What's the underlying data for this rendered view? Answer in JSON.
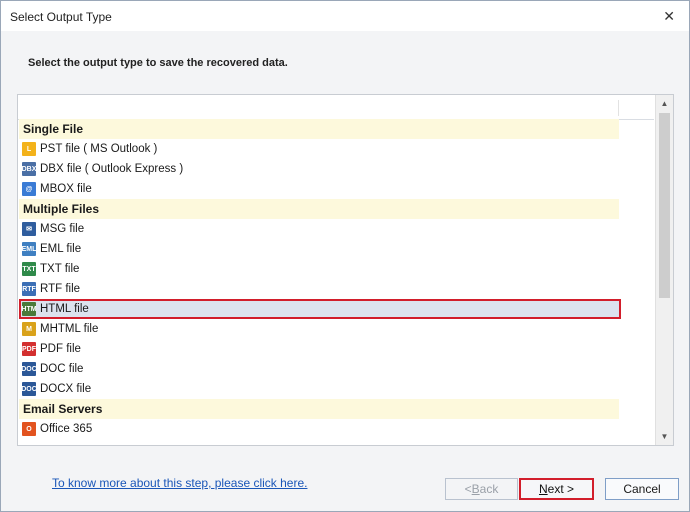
{
  "window": {
    "title": "Select Output Type",
    "close_glyph": "✕"
  },
  "instruction": "Select the output type to save the recovered data.",
  "list": {
    "rows": [
      {
        "type": "group",
        "label": "Single File"
      },
      {
        "type": "item",
        "label": "PST file ( MS Outlook )",
        "icon": "pst-file-icon",
        "icon_text": "L",
        "icon_color": "#f3b21a"
      },
      {
        "type": "item",
        "label": "DBX file ( Outlook Express )",
        "icon": "dbx-file-icon",
        "icon_text": "DBX",
        "icon_color": "#4a6fa5"
      },
      {
        "type": "item",
        "label": "MBOX file",
        "icon": "mbox-file-icon",
        "icon_text": "@",
        "icon_color": "#3a7bd5"
      },
      {
        "type": "group",
        "label": "Multiple Files"
      },
      {
        "type": "item",
        "label": "MSG file",
        "icon": "msg-file-icon",
        "icon_text": "✉",
        "icon_color": "#2f5d9e"
      },
      {
        "type": "item",
        "label": "EML file",
        "icon": "eml-file-icon",
        "icon_text": "EML",
        "icon_color": "#3f7fc1"
      },
      {
        "type": "item",
        "label": "TXT file",
        "icon": "txt-file-icon",
        "icon_text": "TXT",
        "icon_color": "#2f8a4a"
      },
      {
        "type": "item",
        "label": "RTF file",
        "icon": "rtf-file-icon",
        "icon_text": "RTF",
        "icon_color": "#3b6fb6"
      },
      {
        "type": "item",
        "label": "HTML file",
        "icon": "html-file-icon",
        "icon_text": "HTM",
        "icon_color": "#4a7a3a",
        "selected": true
      },
      {
        "type": "item",
        "label": "MHTML file",
        "icon": "mhtml-file-icon",
        "icon_text": "M",
        "icon_color": "#d9a21b"
      },
      {
        "type": "item",
        "label": "PDF file",
        "icon": "pdf-file-icon",
        "icon_text": "PDF",
        "icon_color": "#d32f2f"
      },
      {
        "type": "item",
        "label": "DOC file",
        "icon": "doc-file-icon",
        "icon_text": "DOC",
        "icon_color": "#2b5797"
      },
      {
        "type": "item",
        "label": "DOCX file",
        "icon": "docx-file-icon",
        "icon_text": "DOC",
        "icon_color": "#2b5797"
      },
      {
        "type": "group",
        "label": "Email Servers"
      },
      {
        "type": "item",
        "label": "Office 365",
        "icon": "office-365-icon",
        "icon_text": "O",
        "icon_color": "#e2531f"
      }
    ]
  },
  "footer": {
    "help_link": "To know more about this step, please click here.",
    "back_arrow": "< ",
    "back_mnemonic": "B",
    "back_rest": "ack",
    "next_mnemonic": "N",
    "next_rest": "ext >",
    "cancel_label": "Cancel"
  },
  "colors": {
    "accent_highlight": "#d21e2b",
    "group_background": "#fdf9dc",
    "selection_background": "#dce3ee"
  }
}
